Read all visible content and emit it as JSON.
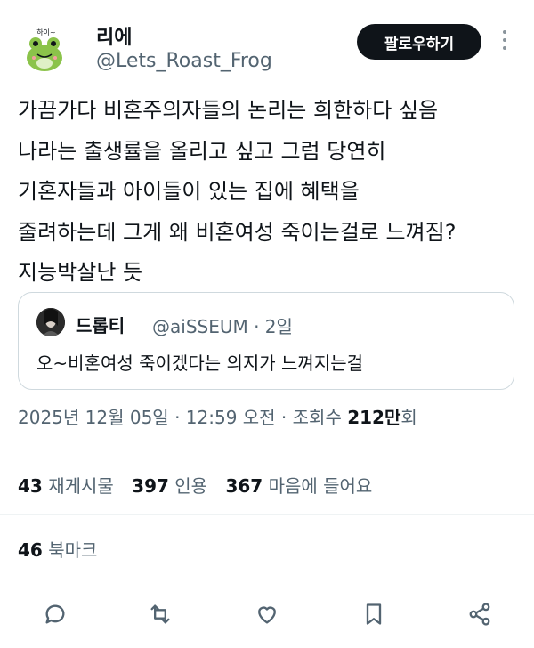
{
  "author": {
    "name": "리에",
    "handle": "@Lets_Roast_Frog",
    "avatar_text": "하이~",
    "avatar_icon": "frog-avatar-icon"
  },
  "follow_label": "팔로우하기",
  "tweet_text": "가끔가다 비혼주의자들의 논리는 희한하다 싶음\n나라는 출생률을 올리고 싶고 그럼 당연히\n기혼자들과 아이들이 있는 집에 혜택을\n줄려하는데 그게 왜 비혼여성 죽이는걸로 느껴짐?\n지능박살난 듯",
  "quote": {
    "name": "드롭티",
    "handle_time": "@aiSSEUM · 2일",
    "text": "오~비혼여성 죽이겠다는 의지가 느껴지는걸"
  },
  "meta": {
    "datetime": "2025년 12월 05일 · 12:59 오전 · 조회수 ",
    "views": "212만",
    "views_suffix": "회"
  },
  "stats": {
    "retweets_count": "43",
    "retweets_label": "재게시물",
    "quotes_count": "397",
    "quotes_label": "인용",
    "likes_count": "367",
    "likes_label": "마음에 들어요"
  },
  "bookmarks": {
    "count": "46",
    "label": "북마크"
  },
  "actions": [
    "reply-icon",
    "retweet-icon",
    "like-icon",
    "bookmark-icon",
    "share-icon"
  ],
  "colors": {
    "text": "#0f1419",
    "secondary": "#536471",
    "border": "#cfd9de",
    "button_bg": "#0f1419"
  }
}
